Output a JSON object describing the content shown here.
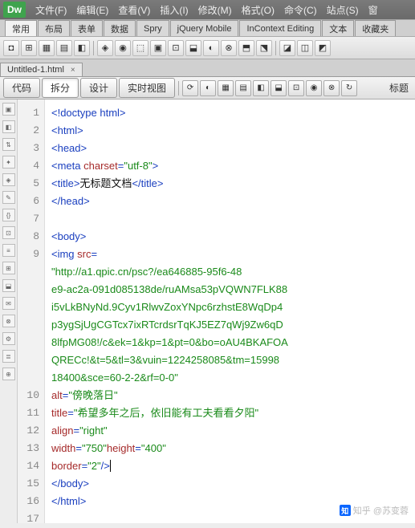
{
  "app": {
    "logo": "Dw"
  },
  "menus": [
    "文件(F)",
    "编辑(E)",
    "查看(V)",
    "插入(I)",
    "修改(M)",
    "格式(O)",
    "命令(C)",
    "站点(S)",
    "窗"
  ],
  "categories": [
    "常用",
    "布局",
    "表单",
    "数据",
    "Spry",
    "jQuery Mobile",
    "InContext Editing",
    "文本",
    "收藏夹"
  ],
  "active_category": 0,
  "doc_tab": {
    "name": "Untitled-1.html",
    "close": "×"
  },
  "view": {
    "buttons": [
      "代码",
      "拆分",
      "设计",
      "实时视图"
    ],
    "active": 1,
    "title_label": "标题"
  },
  "code": {
    "lines": [
      {
        "n": "1",
        "html": "<span class='tag'>&lt;!doctype html&gt;</span>"
      },
      {
        "n": "2",
        "html": "<span class='tag'>&lt;html&gt;</span>"
      },
      {
        "n": "3",
        "html": "<span class='tag'>&lt;head&gt;</span>"
      },
      {
        "n": "4",
        "html": "<span class='tag'>&lt;meta </span><span class='attr'>charset</span><span class='tag'>=</span><span class='val'>\"utf-8\"</span><span class='tag'>&gt;</span>"
      },
      {
        "n": "5",
        "html": "<span class='tag'>&lt;title&gt;</span><span class='txt'>无标题文档</span><span class='tag'>&lt;/title&gt;</span>"
      },
      {
        "n": "6",
        "html": "<span class='tag'>&lt;/head&gt;</span>"
      },
      {
        "n": "7",
        "html": ""
      },
      {
        "n": "8",
        "html": "<span class='tag'>&lt;body&gt;</span>"
      },
      {
        "n": "9",
        "html": "<span class='tag'>&lt;img </span><span class='attr'>src</span><span class='tag'>=</span>"
      },
      {
        "n": "",
        "html": "<span class='val'>\"http://a1.qpic.cn/psc?/ea646885-95f6-48</span>"
      },
      {
        "n": "",
        "html": "<span class='val'>e9-ac2a-091d085138de/ruAMsa53pVQWN7FLK88</span>"
      },
      {
        "n": "",
        "html": "<span class='val'>i5vLkBNyNd.9Cyv1RlwvZoxYNpc6rzhstE8WqDp4</span>"
      },
      {
        "n": "",
        "html": "<span class='val'>p3ygSjUgCGTcx7ixRTcrdsrTqKJ5EZ7qWj9Zw6qD</span>"
      },
      {
        "n": "",
        "html": "<span class='val'>8lfpMG08!/c&amp;ek=1&amp;kp=1&amp;pt=0&amp;bo=oAU4BKAFOA</span>"
      },
      {
        "n": "",
        "html": "<span class='val'>QRECc!&amp;t=5&amp;tl=3&amp;vuin=1224258085&amp;tm=15998</span>"
      },
      {
        "n": "",
        "html": "<span class='val'>18400&amp;sce=60-2-2&amp;rf=0-0\"</span>"
      },
      {
        "n": "10",
        "html": "<span class='attr'>alt</span><span class='tag'>=</span><span class='val'>\"傍晚落日\"</span>"
      },
      {
        "n": "11",
        "html": "<span class='attr'>title</span><span class='tag'>=</span><span class='val'>\"希望多年之后，依旧能有工夫看看夕阳\"</span>"
      },
      {
        "n": "12",
        "html": "<span class='attr'>align</span><span class='tag'>=</span><span class='val'>\"right\"</span>"
      },
      {
        "n": "13",
        "html": "<span class='attr'>width</span><span class='tag'>=</span><span class='val'>\"750\"</span><span class='attr'>height</span><span class='tag'>=</span><span class='val'>\"400\"</span>"
      },
      {
        "n": "14",
        "html": "<span class='attr'>border</span><span class='tag'>=</span><span class='val'>\"2\"</span><span class='tag'>/&gt;</span><span style='border-left:1px solid #000'></span>"
      },
      {
        "n": "15",
        "html": "<span class='tag'>&lt;/body&gt;</span>"
      },
      {
        "n": "16",
        "html": "<span class='tag'>&lt;/html&gt;</span>"
      },
      {
        "n": "17",
        "html": ""
      }
    ]
  },
  "watermark": {
    "text": "知乎 @苏变蓉",
    "logo": "知"
  },
  "icons": {
    "tools": [
      "◘",
      "⊞",
      "▦",
      "▤",
      "◧",
      "—",
      "◈",
      "◉",
      "⬚",
      "▣",
      "⊡",
      "⬓",
      "◐",
      "⊗",
      "⬒",
      "⬔",
      "—",
      "◪",
      "◫",
      "◩"
    ],
    "small": [
      "⟳",
      "◐",
      "▦",
      "▤",
      "◧",
      "⬓",
      "⊡",
      "◉",
      "⊗",
      "↻"
    ],
    "vtools": [
      "▣",
      "◧",
      "⇅",
      "✦",
      "◈",
      "✎",
      "{}",
      "⊡",
      "≡",
      "⊞",
      "⬓",
      "✉",
      "⊗",
      "⚙",
      "≣",
      "⊕"
    ]
  }
}
